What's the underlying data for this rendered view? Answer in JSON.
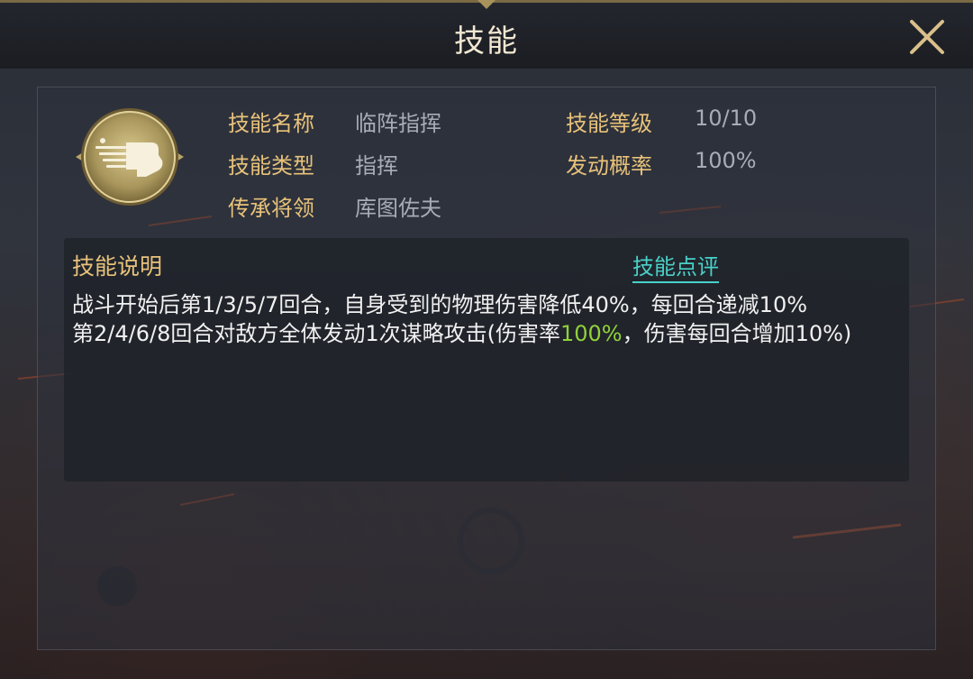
{
  "header": {
    "title": "技能",
    "close_icon": "close-icon"
  },
  "skill": {
    "icon": "hand-pointing-skill-icon",
    "name_label": "技能名称",
    "name_value": "临阵指挥",
    "level_label": "技能等级",
    "level_value": "10/10",
    "type_label": "技能类型",
    "type_value": "指挥",
    "chance_label": "发动概率",
    "chance_value": "100%",
    "inherit_label": "传承将领",
    "inherit_value": "库图佐夫"
  },
  "description": {
    "title": "技能说明",
    "review_link": "技能点评",
    "line1": "战斗开始后第1/3/5/7回合，自身受到的物理伤害降低40%，每回合递减10%",
    "line2_before": "第2/4/6/8回合对敌方全体发动1次谋略攻击(伤害率",
    "line2_highlight": "100%",
    "line2_after": "，伤害每回合增加10%)"
  },
  "colors": {
    "label_gold": "#e8c27a",
    "value_gray": "#a7acb6",
    "link_cyan": "#48d1c8",
    "highlight_green": "#8fd13a"
  }
}
